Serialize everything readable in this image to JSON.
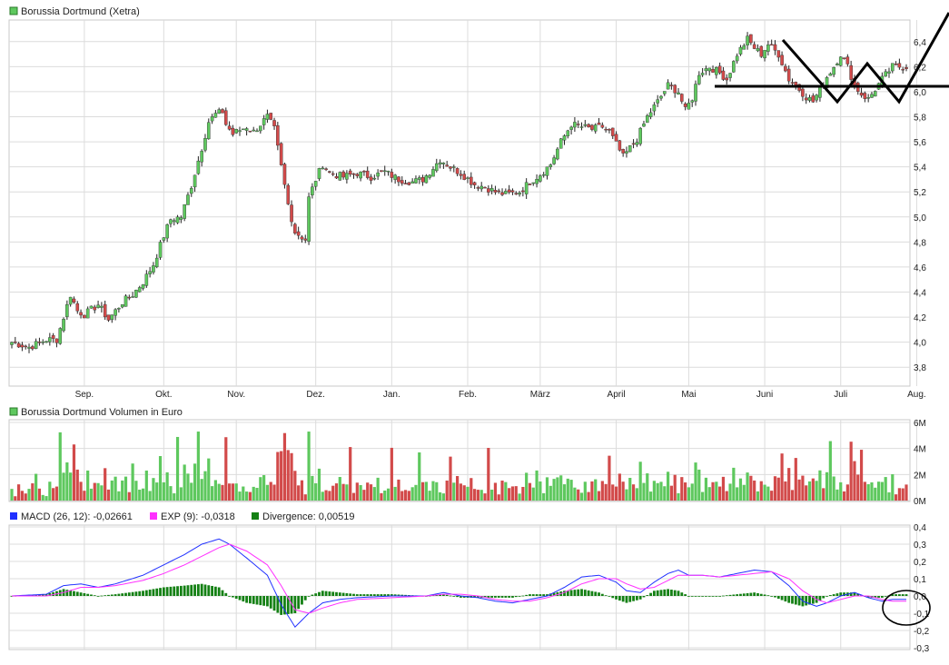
{
  "colors": {
    "up": "#5ec85e",
    "down": "#d24a4a",
    "wick": "#222222",
    "grid": "#dcdcdc",
    "macd": "#2030ff",
    "signal": "#ff30ff",
    "divergence": "#148014",
    "annotation": "#000000"
  },
  "chart_data": [
    {
      "type": "candlestick",
      "title": "Borussia Dortmund (Xetra)",
      "months": [
        "Sep.",
        "Okt.",
        "Nov.",
        "Dez.",
        "Jan.",
        "Feb.",
        "März",
        "April",
        "Mai",
        "Juni",
        "Juli",
        "Aug."
      ],
      "month_start_index": [
        21,
        44,
        65,
        88,
        110,
        132,
        153,
        175,
        196,
        218,
        240,
        262
      ],
      "yticks": [
        "3,8",
        "4,0",
        "4,2",
        "4,4",
        "4,6",
        "4,8",
        "5,0",
        "5,2",
        "5,4",
        "5,6",
        "5,8",
        "6,0",
        "6,2",
        "6,4"
      ],
      "ylim": [
        3.7,
        6.5
      ],
      "grid": true,
      "anchors": [
        [
          0,
          4.0
        ],
        [
          5,
          3.96
        ],
        [
          10,
          4.02
        ],
        [
          13,
          4.02
        ],
        [
          15,
          4.2
        ],
        [
          17,
          4.38
        ],
        [
          19,
          4.25
        ],
        [
          21,
          4.22
        ],
        [
          25,
          4.3
        ],
        [
          28,
          4.18
        ],
        [
          32,
          4.32
        ],
        [
          35,
          4.38
        ],
        [
          38,
          4.48
        ],
        [
          41,
          4.62
        ],
        [
          44,
          4.85
        ],
        [
          46,
          4.98
        ],
        [
          49,
          5.0
        ],
        [
          52,
          5.25
        ],
        [
          55,
          5.55
        ],
        [
          57,
          5.76
        ],
        [
          59,
          5.82
        ],
        [
          61,
          5.84
        ],
        [
          62,
          5.74
        ],
        [
          64,
          5.66
        ],
        [
          65,
          5.68
        ],
        [
          68,
          5.72
        ],
        [
          70,
          5.68
        ],
        [
          72,
          5.74
        ],
        [
          74,
          5.8
        ],
        [
          76,
          5.7
        ],
        [
          78,
          5.4
        ],
        [
          80,
          5.1
        ],
        [
          82,
          4.88
        ],
        [
          85,
          4.82
        ],
        [
          86,
          5.15
        ],
        [
          88,
          5.3
        ],
        [
          90,
          5.42
        ],
        [
          92,
          5.35
        ],
        [
          96,
          5.32
        ],
        [
          100,
          5.35
        ],
        [
          104,
          5.32
        ],
        [
          108,
          5.36
        ],
        [
          112,
          5.3
        ],
        [
          116,
          5.28
        ],
        [
          119,
          5.3
        ],
        [
          121,
          5.36
        ],
        [
          124,
          5.46
        ],
        [
          127,
          5.4
        ],
        [
          130,
          5.35
        ],
        [
          134,
          5.26
        ],
        [
          137,
          5.24
        ],
        [
          140,
          5.2
        ],
        [
          143,
          5.18
        ],
        [
          147,
          5.2
        ],
        [
          150,
          5.28
        ],
        [
          153,
          5.34
        ],
        [
          156,
          5.42
        ],
        [
          159,
          5.6
        ],
        [
          162,
          5.74
        ],
        [
          165,
          5.72
        ],
        [
          168,
          5.7
        ],
        [
          171,
          5.72
        ],
        [
          173,
          5.68
        ],
        [
          175,
          5.58
        ],
        [
          177,
          5.48
        ],
        [
          179,
          5.55
        ],
        [
          181,
          5.62
        ],
        [
          184,
          5.8
        ],
        [
          187,
          5.92
        ],
        [
          190,
          6.05
        ],
        [
          193,
          6.0
        ],
        [
          195,
          5.85
        ],
        [
          197,
          5.95
        ],
        [
          199,
          6.15
        ],
        [
          202,
          6.2
        ],
        [
          205,
          6.15
        ],
        [
          207,
          6.1
        ],
        [
          210,
          6.3
        ],
        [
          213,
          6.42
        ],
        [
          215,
          6.35
        ],
        [
          217,
          6.3
        ],
        [
          219,
          6.38
        ],
        [
          222,
          6.3
        ],
        [
          225,
          6.1
        ],
        [
          228,
          6.02
        ],
        [
          230,
          5.96
        ],
        [
          232,
          5.92
        ],
        [
          234,
          6.02
        ],
        [
          236,
          6.12
        ],
        [
          238,
          6.2
        ],
        [
          240,
          6.3
        ],
        [
          242,
          6.2
        ],
        [
          244,
          6.05
        ],
        [
          246,
          5.98
        ],
        [
          248,
          5.94
        ],
        [
          250,
          6.02
        ],
        [
          252,
          6.1
        ],
        [
          255,
          6.2
        ]
      ],
      "volume": {
        "title": "Borussia Dortmund Volumen in Euro",
        "yticks": [
          "0M",
          "2M",
          "4M",
          "6M"
        ],
        "ylim": [
          0,
          6
        ],
        "unit": "M€"
      },
      "macd": {
        "legend": [
          {
            "name": "MACD (26, 12): -0,02661",
            "color": "#2030ff"
          },
          {
            "name": "EXP (9): -0,0318",
            "color": "#ff30ff"
          },
          {
            "name": "Divergence: 0,00519",
            "color": "#148014"
          }
        ],
        "yticks": [
          "-0,3",
          "-0,2",
          "-0,1",
          "0,0",
          "0,1",
          "0,2",
          "0,3",
          "0,4"
        ],
        "ylim": [
          -0.3,
          0.4
        ],
        "macd_anchors": [
          [
            0,
            0
          ],
          [
            10,
            0.01
          ],
          [
            15,
            0.06
          ],
          [
            20,
            0.07
          ],
          [
            25,
            0.05
          ],
          [
            30,
            0.07
          ],
          [
            38,
            0.12
          ],
          [
            44,
            0.18
          ],
          [
            50,
            0.24
          ],
          [
            55,
            0.3
          ],
          [
            60,
            0.33
          ],
          [
            63,
            0.3
          ],
          [
            68,
            0.22
          ],
          [
            74,
            0.12
          ],
          [
            78,
            -0.05
          ],
          [
            82,
            -0.18
          ],
          [
            86,
            -0.1
          ],
          [
            90,
            -0.04
          ],
          [
            95,
            -0.02
          ],
          [
            100,
            -0.01
          ],
          [
            110,
            0.0
          ],
          [
            120,
            0.0
          ],
          [
            125,
            0.02
          ],
          [
            130,
            0.0
          ],
          [
            135,
            -0.01
          ],
          [
            140,
            -0.03
          ],
          [
            145,
            -0.04
          ],
          [
            150,
            -0.02
          ],
          [
            155,
            0.0
          ],
          [
            160,
            0.05
          ],
          [
            165,
            0.11
          ],
          [
            170,
            0.12
          ],
          [
            175,
            0.08
          ],
          [
            178,
            0.03
          ],
          [
            182,
            0.02
          ],
          [
            186,
            0.08
          ],
          [
            190,
            0.13
          ],
          [
            193,
            0.15
          ],
          [
            196,
            0.12
          ],
          [
            200,
            0.12
          ],
          [
            205,
            0.11
          ],
          [
            210,
            0.13
          ],
          [
            215,
            0.15
          ],
          [
            220,
            0.14
          ],
          [
            225,
            0.06
          ],
          [
            229,
            -0.03
          ],
          [
            233,
            -0.06
          ],
          [
            236,
            -0.04
          ],
          [
            240,
            0.0
          ],
          [
            244,
            0.02
          ],
          [
            248,
            -0.01
          ],
          [
            252,
            -0.03
          ],
          [
            255,
            -0.02
          ]
        ],
        "signal_anchors": [
          [
            0,
            0
          ],
          [
            10,
            0.0
          ],
          [
            15,
            0.02
          ],
          [
            20,
            0.05
          ],
          [
            25,
            0.05
          ],
          [
            30,
            0.06
          ],
          [
            38,
            0.09
          ],
          [
            44,
            0.13
          ],
          [
            50,
            0.18
          ],
          [
            55,
            0.23
          ],
          [
            60,
            0.28
          ],
          [
            63,
            0.3
          ],
          [
            68,
            0.26
          ],
          [
            74,
            0.18
          ],
          [
            78,
            0.06
          ],
          [
            82,
            -0.08
          ],
          [
            86,
            -0.1
          ],
          [
            90,
            -0.07
          ],
          [
            95,
            -0.04
          ],
          [
            100,
            -0.02
          ],
          [
            110,
            -0.01
          ],
          [
            120,
            0.0
          ],
          [
            125,
            0.01
          ],
          [
            130,
            0.01
          ],
          [
            135,
            0.0
          ],
          [
            140,
            -0.02
          ],
          [
            145,
            -0.03
          ],
          [
            150,
            -0.03
          ],
          [
            155,
            -0.01
          ],
          [
            160,
            0.02
          ],
          [
            165,
            0.07
          ],
          [
            170,
            0.1
          ],
          [
            175,
            0.1
          ],
          [
            178,
            0.07
          ],
          [
            182,
            0.04
          ],
          [
            186,
            0.05
          ],
          [
            190,
            0.09
          ],
          [
            193,
            0.12
          ],
          [
            196,
            0.12
          ],
          [
            200,
            0.12
          ],
          [
            205,
            0.11
          ],
          [
            210,
            0.12
          ],
          [
            215,
            0.13
          ],
          [
            220,
            0.14
          ],
          [
            225,
            0.1
          ],
          [
            229,
            0.03
          ],
          [
            233,
            -0.02
          ],
          [
            236,
            -0.04
          ],
          [
            240,
            -0.02
          ],
          [
            244,
            0.0
          ],
          [
            248,
            0.0
          ],
          [
            252,
            -0.02
          ],
          [
            255,
            -0.03
          ]
        ]
      }
    }
  ]
}
